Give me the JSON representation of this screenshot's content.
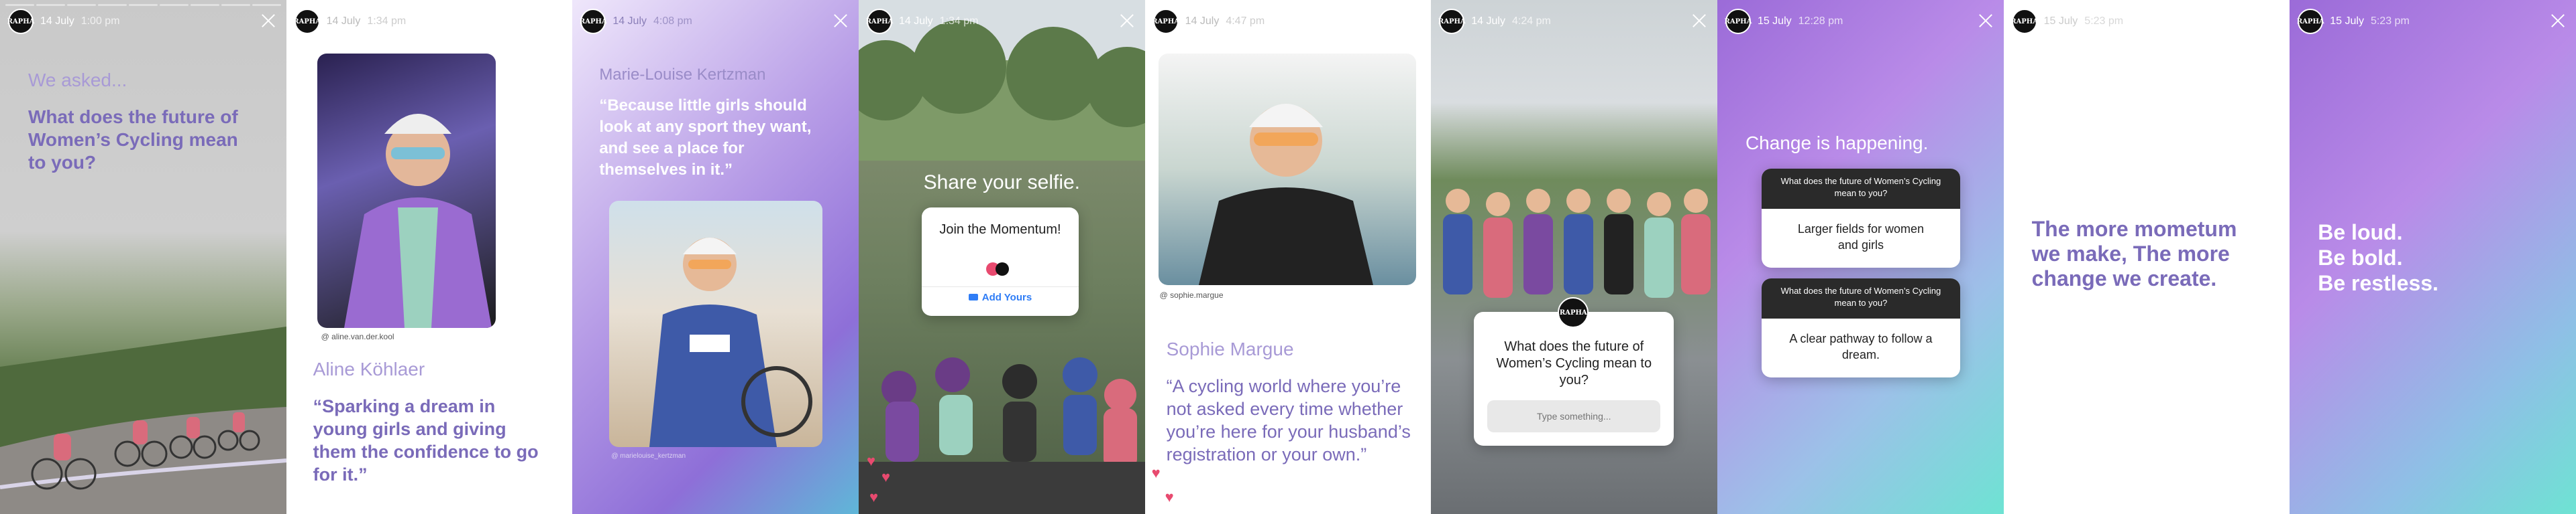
{
  "brand": {
    "avatar_text": "RAPHA"
  },
  "stories": [
    {
      "date": "14 July",
      "time": "1:00 pm"
    },
    {
      "date": "14 July",
      "time": "1:34 pm"
    },
    {
      "date": "14 July",
      "time": "4:08 pm"
    },
    {
      "date": "14 July",
      "time": "1:34 pm"
    },
    {
      "date": "14 July",
      "time": "4:47 pm"
    },
    {
      "date": "14 July",
      "time": "4:24 pm"
    },
    {
      "date": "15 July",
      "time": "12:28 pm"
    },
    {
      "date": "15 July",
      "time": "5:23 pm"
    },
    {
      "date": "15 July",
      "time": "5:23 pm"
    }
  ],
  "s1": {
    "kicker": "We asked...",
    "question": "What does the future of Women’s Cycling mean to you?"
  },
  "s2": {
    "handle": "@ aline.van.der.kool",
    "name": "Aline Köhlaer",
    "quote": "“Sparking a dream in young girls and giving them the confidence to go for it.”"
  },
  "s3": {
    "name": "Marie-Louise Kertzman",
    "quote": "“Because little girls should look at any sport they want, and see a place for themselves in it.”",
    "handle": "@ marielouise_kertzman"
  },
  "s4": {
    "heading": "Share your selfie.",
    "card_title": "Join the Momentum!",
    "add_label": "Add Yours"
  },
  "s5": {
    "handle": "@ sophie.margue",
    "name": "Sophie Margue",
    "quote": "“A cycling world where you’re not asked every time whether you’re here for your husband’s registration or your own.”"
  },
  "s6": {
    "question": "What does the future of Women’s Cycling mean to you?",
    "placeholder": "Type something..."
  },
  "s7": {
    "heading": "Change is happening.",
    "q1": "What does the future of Women’s Cycling mean to you?",
    "a1": "Larger fields for women and girls",
    "q2": "What does the future of Women’s Cycling mean to you?",
    "a2": "A clear pathway to follow a dream."
  },
  "s8": {
    "text": "The more mometum we make, The more change we create."
  },
  "s9": {
    "line1": "Be loud.",
    "line2": "Be bold.",
    "line3": "Be restless."
  }
}
